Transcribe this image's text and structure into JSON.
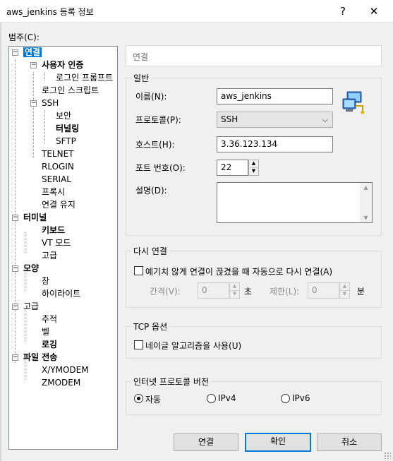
{
  "window": {
    "title": "aws_jenkins 등록 정보",
    "help_label": "?",
    "close_label": "✕"
  },
  "category_label": "범주(C):",
  "tree": {
    "items": [
      {
        "label": "연결",
        "bold": true,
        "selected": true
      },
      {
        "label": "사용자 인증",
        "bold": true
      },
      {
        "label": "로그인 프롬프트",
        "bold": false
      },
      {
        "label": "로그인 스크립트",
        "bold": false
      },
      {
        "label": "SSH",
        "bold": false
      },
      {
        "label": "보안",
        "bold": false
      },
      {
        "label": "터널링",
        "bold": true
      },
      {
        "label": "SFTP",
        "bold": false
      },
      {
        "label": "TELNET",
        "bold": false
      },
      {
        "label": "RLOGIN",
        "bold": false
      },
      {
        "label": "SERIAL",
        "bold": false
      },
      {
        "label": "프록시",
        "bold": false
      },
      {
        "label": "연결 유지",
        "bold": false
      },
      {
        "label": "터미널",
        "bold": true
      },
      {
        "label": "키보드",
        "bold": true
      },
      {
        "label": "VT 모드",
        "bold": false
      },
      {
        "label": "고급",
        "bold": false
      },
      {
        "label": "모양",
        "bold": true
      },
      {
        "label": "창",
        "bold": false
      },
      {
        "label": "하이라이트",
        "bold": false
      },
      {
        "label": "고급",
        "bold": false
      },
      {
        "label": "추적",
        "bold": false
      },
      {
        "label": "벨",
        "bold": false
      },
      {
        "label": "로깅",
        "bold": true
      },
      {
        "label": "파일 전송",
        "bold": true
      },
      {
        "label": "X/YMODEM",
        "bold": false
      },
      {
        "label": "ZMODEM",
        "bold": false
      }
    ]
  },
  "panel_header": "연결",
  "general": {
    "legend": "일반",
    "name_label": "이름(N):",
    "name_value": "aws_jenkins",
    "protocol_label": "프로토콜(P):",
    "protocol_value": "SSH",
    "host_label": "호스트(H):",
    "host_value": "3.36.123.134",
    "port_label": "포트 번호(O):",
    "port_value": "22",
    "desc_label": "설명(D):",
    "desc_value": ""
  },
  "reconnect": {
    "legend": "다시 연결",
    "auto_label": "예기치 않게 연결이 끊겼을 때 자동으로 다시 연결(A)",
    "interval_label": "간격(V):",
    "interval_value": "0",
    "interval_unit": "초",
    "limit_label": "제한(L):",
    "limit_value": "0",
    "limit_unit": "분"
  },
  "tcp": {
    "legend": "TCP 옵션",
    "nagle_label": "네이글 알고리즘을 사용(U)"
  },
  "ipver": {
    "legend": "인터넷 프로토콜 버전",
    "options": [
      "자동",
      "IPv4",
      "IPv6"
    ],
    "selected": "자동"
  },
  "buttons": {
    "connect": "연결",
    "ok": "확인",
    "cancel": "취소"
  },
  "colors": {
    "selection": "#0078d7",
    "window_bg": "#f0f0f0"
  }
}
